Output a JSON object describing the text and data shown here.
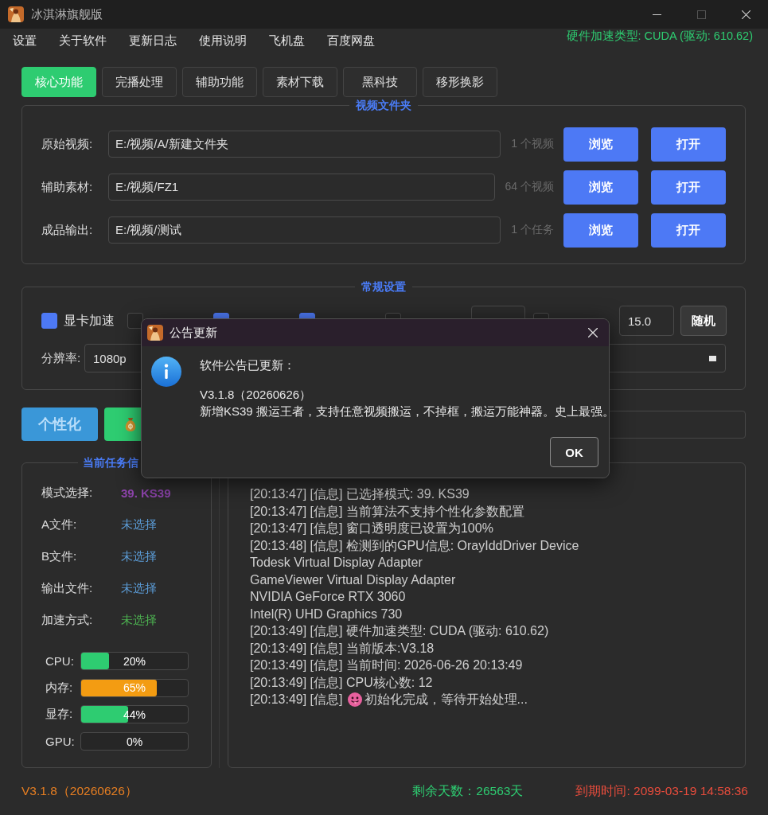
{
  "window": {
    "title": "冰淇淋旗舰版",
    "controls": [
      {
        "kind": "minimize",
        "disabled": false
      },
      {
        "kind": "maximize",
        "disabled": true
      },
      {
        "kind": "close",
        "disabled": false
      }
    ]
  },
  "menu": {
    "items": [
      "设置",
      "关于软件",
      "更新日志",
      "使用说明",
      "飞机盘",
      "百度网盘"
    ],
    "status": "硬件加速类型: CUDA (驱动: 610.62)"
  },
  "tabs": [
    {
      "label": "核心功能",
      "selected": true
    },
    {
      "label": "完播处理",
      "selected": false
    },
    {
      "label": "辅助功能",
      "selected": false
    },
    {
      "label": "素材下载",
      "selected": false
    },
    {
      "label": "黑科技",
      "selected": false
    },
    {
      "label": "移形换影",
      "selected": false
    }
  ],
  "video_folders": {
    "title": "视频文件夹",
    "rows": [
      {
        "label": "原始视频:",
        "path": "E:/视频/A/新建文件夹",
        "count": "1 个视频",
        "browse": "浏览",
        "open": "打开"
      },
      {
        "label": "辅助素材:",
        "path": "E:/视频/FZ1",
        "count": "64 个视频",
        "browse": "浏览",
        "open": "打开"
      },
      {
        "label": "成品输出:",
        "path": "E:/视频/测试",
        "count": "1 个任务",
        "browse": "浏览",
        "open": "打开"
      }
    ]
  },
  "settings": {
    "title": "常规设置",
    "controls": [
      {
        "kind": "checkbox",
        "label": "显卡加速",
        "checked": true
      },
      {
        "kind": "checkbox",
        "checked": false
      },
      {
        "kind": "checkbox",
        "checked": true
      },
      {
        "kind": "checkbox",
        "checked": true
      },
      {
        "kind": "checkbox",
        "checked": false
      },
      {
        "kind": "dropdown"
      },
      {
        "kind": "checkbox",
        "checked": false
      },
      {
        "kind": "number",
        "value": "15.0"
      },
      {
        "kind": "button",
        "label": "随机"
      }
    ],
    "resolution": {
      "label": "分辨率:",
      "value": "1080p"
    }
  },
  "action_bar": [
    {
      "kind": "text_button",
      "label": "个性化",
      "disabled": true
    },
    {
      "kind": "icon_button"
    },
    {
      "kind": "field"
    }
  ],
  "task_info": {
    "title": "当前任务信",
    "rows": [
      {
        "label": "模式选择:",
        "value": "39. KS39",
        "color": "#8e44ad",
        "bold": true
      },
      {
        "label": "A文件:",
        "value": "未选择",
        "color": "#5b9bd5",
        "bold": false
      },
      {
        "label": "B文件:",
        "value": "未选择",
        "color": "#5b9bd5",
        "bold": false
      },
      {
        "label": "输出文件:",
        "value": "未选择",
        "color": "#5b9bd5",
        "bold": false
      },
      {
        "label": "加速方式:",
        "value": "未选择",
        "color": "#4caf50",
        "bold": false
      }
    ],
    "meters": [
      {
        "label": "CPU:",
        "reading": "20%",
        "level": 0.26,
        "color": "#2ecc71"
      },
      {
        "label": "内存:",
        "reading": "65%",
        "level": 0.71,
        "color": "#f39c12"
      },
      {
        "label": "显存:",
        "reading": "44%",
        "level": 0.44,
        "color": "#2ecc71"
      },
      {
        "label": "GPU:",
        "reading": "0%"
      }
    ]
  },
  "log": {
    "lines": [
      {
        "kind": "text",
        "text": "[20:13:47] [信息] 已选择模式: 39. KS39"
      },
      {
        "kind": "text",
        "text": "[20:13:47] [信息] 当前算法不支持个性化参数配置"
      },
      {
        "kind": "text",
        "text": "[20:13:47] [信息] 窗口透明度已设置为100%"
      },
      {
        "kind": "text",
        "text": "[20:13:48] [信息] 检测到的GPU信息: OrayIddDriver Device"
      },
      {
        "kind": "text",
        "text": "Todesk Virtual Display Adapter"
      },
      {
        "kind": "text",
        "text": "GameViewer Virtual Display Adapter"
      },
      {
        "kind": "text",
        "text": "NVIDIA GeForce RTX 3060"
      },
      {
        "kind": "text",
        "text": "Intel(R) UHD Graphics 730"
      },
      {
        "kind": "text",
        "text": "[20:13:49] [信息] 硬件加速类型: CUDA (驱动: 610.62)"
      },
      {
        "kind": "text",
        "text": "[20:13:49] [信息] 当前版本:V3.18"
      },
      {
        "kind": "text",
        "text": "[20:13:49] [信息] 当前时间: 2026-06-26 20:13:49"
      },
      {
        "kind": "text",
        "text": "[20:13:49] [信息] CPU核心数: 12"
      },
      {
        "kind": "emoji",
        "prefix": "[20:13:49] [信息]",
        "text": "初始化完成，等待开始处理..."
      }
    ]
  },
  "notice_dialog": {
    "title": "公告更新",
    "paragraphs": [
      [
        "软件公告已更新："
      ],
      [
        "V3.1.8（20260626）",
        "新增KS39 搬运王者，支持任意视频搬运，不掉框，搬运万能神器。史上最强。"
      ]
    ],
    "ok": "OK"
  },
  "footer": {
    "version": "V3.1.8（20260626）",
    "days": "剩余天数：26563天",
    "expiry": "到期时间: 2099-03-19 14:58:36"
  }
}
